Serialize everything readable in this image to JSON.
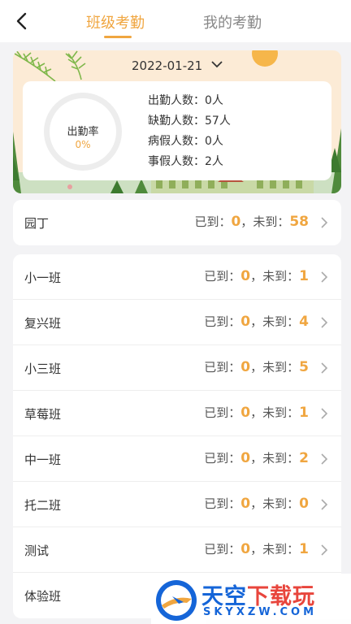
{
  "header": {
    "tabs": [
      {
        "label": "班级考勤",
        "active": true
      },
      {
        "label": "我的考勤",
        "active": false
      }
    ]
  },
  "summary": {
    "date": "2022-01-21",
    "rate_label": "出勤率",
    "rate_value": "0%",
    "stats": [
      "出勤人数：0人",
      "缺勤人数：57人",
      "病假人数：0人",
      "事假人数：2人"
    ]
  },
  "labels": {
    "arrived": "已到：",
    "sep": "，",
    "absent": "未到："
  },
  "staff": {
    "name": "园丁",
    "arrived": "0",
    "absent": "58"
  },
  "classes": [
    {
      "name": "小一班",
      "arrived": "0",
      "absent": "1"
    },
    {
      "name": "复兴班",
      "arrived": "0",
      "absent": "4"
    },
    {
      "name": "小三班",
      "arrived": "0",
      "absent": "5"
    },
    {
      "name": "草莓班",
      "arrived": "0",
      "absent": "1"
    },
    {
      "name": "中一班",
      "arrived": "0",
      "absent": "2"
    },
    {
      "name": "托二班",
      "arrived": "0",
      "absent": "0"
    },
    {
      "name": "测试",
      "arrived": "0",
      "absent": "1"
    },
    {
      "name": "体验班"
    }
  ],
  "watermark": {
    "main_a": "天空",
    "main_b": "下载玩",
    "sub": "SKYXZW.COM"
  },
  "colors": {
    "accent": "#f0a640",
    "watermark_blue": "#1565d8",
    "watermark_red": "#e8453c"
  },
  "icons": [
    "back-arrow-icon",
    "chevron-down-icon",
    "chevron-right-icon",
    "sky-logo-icon"
  ]
}
